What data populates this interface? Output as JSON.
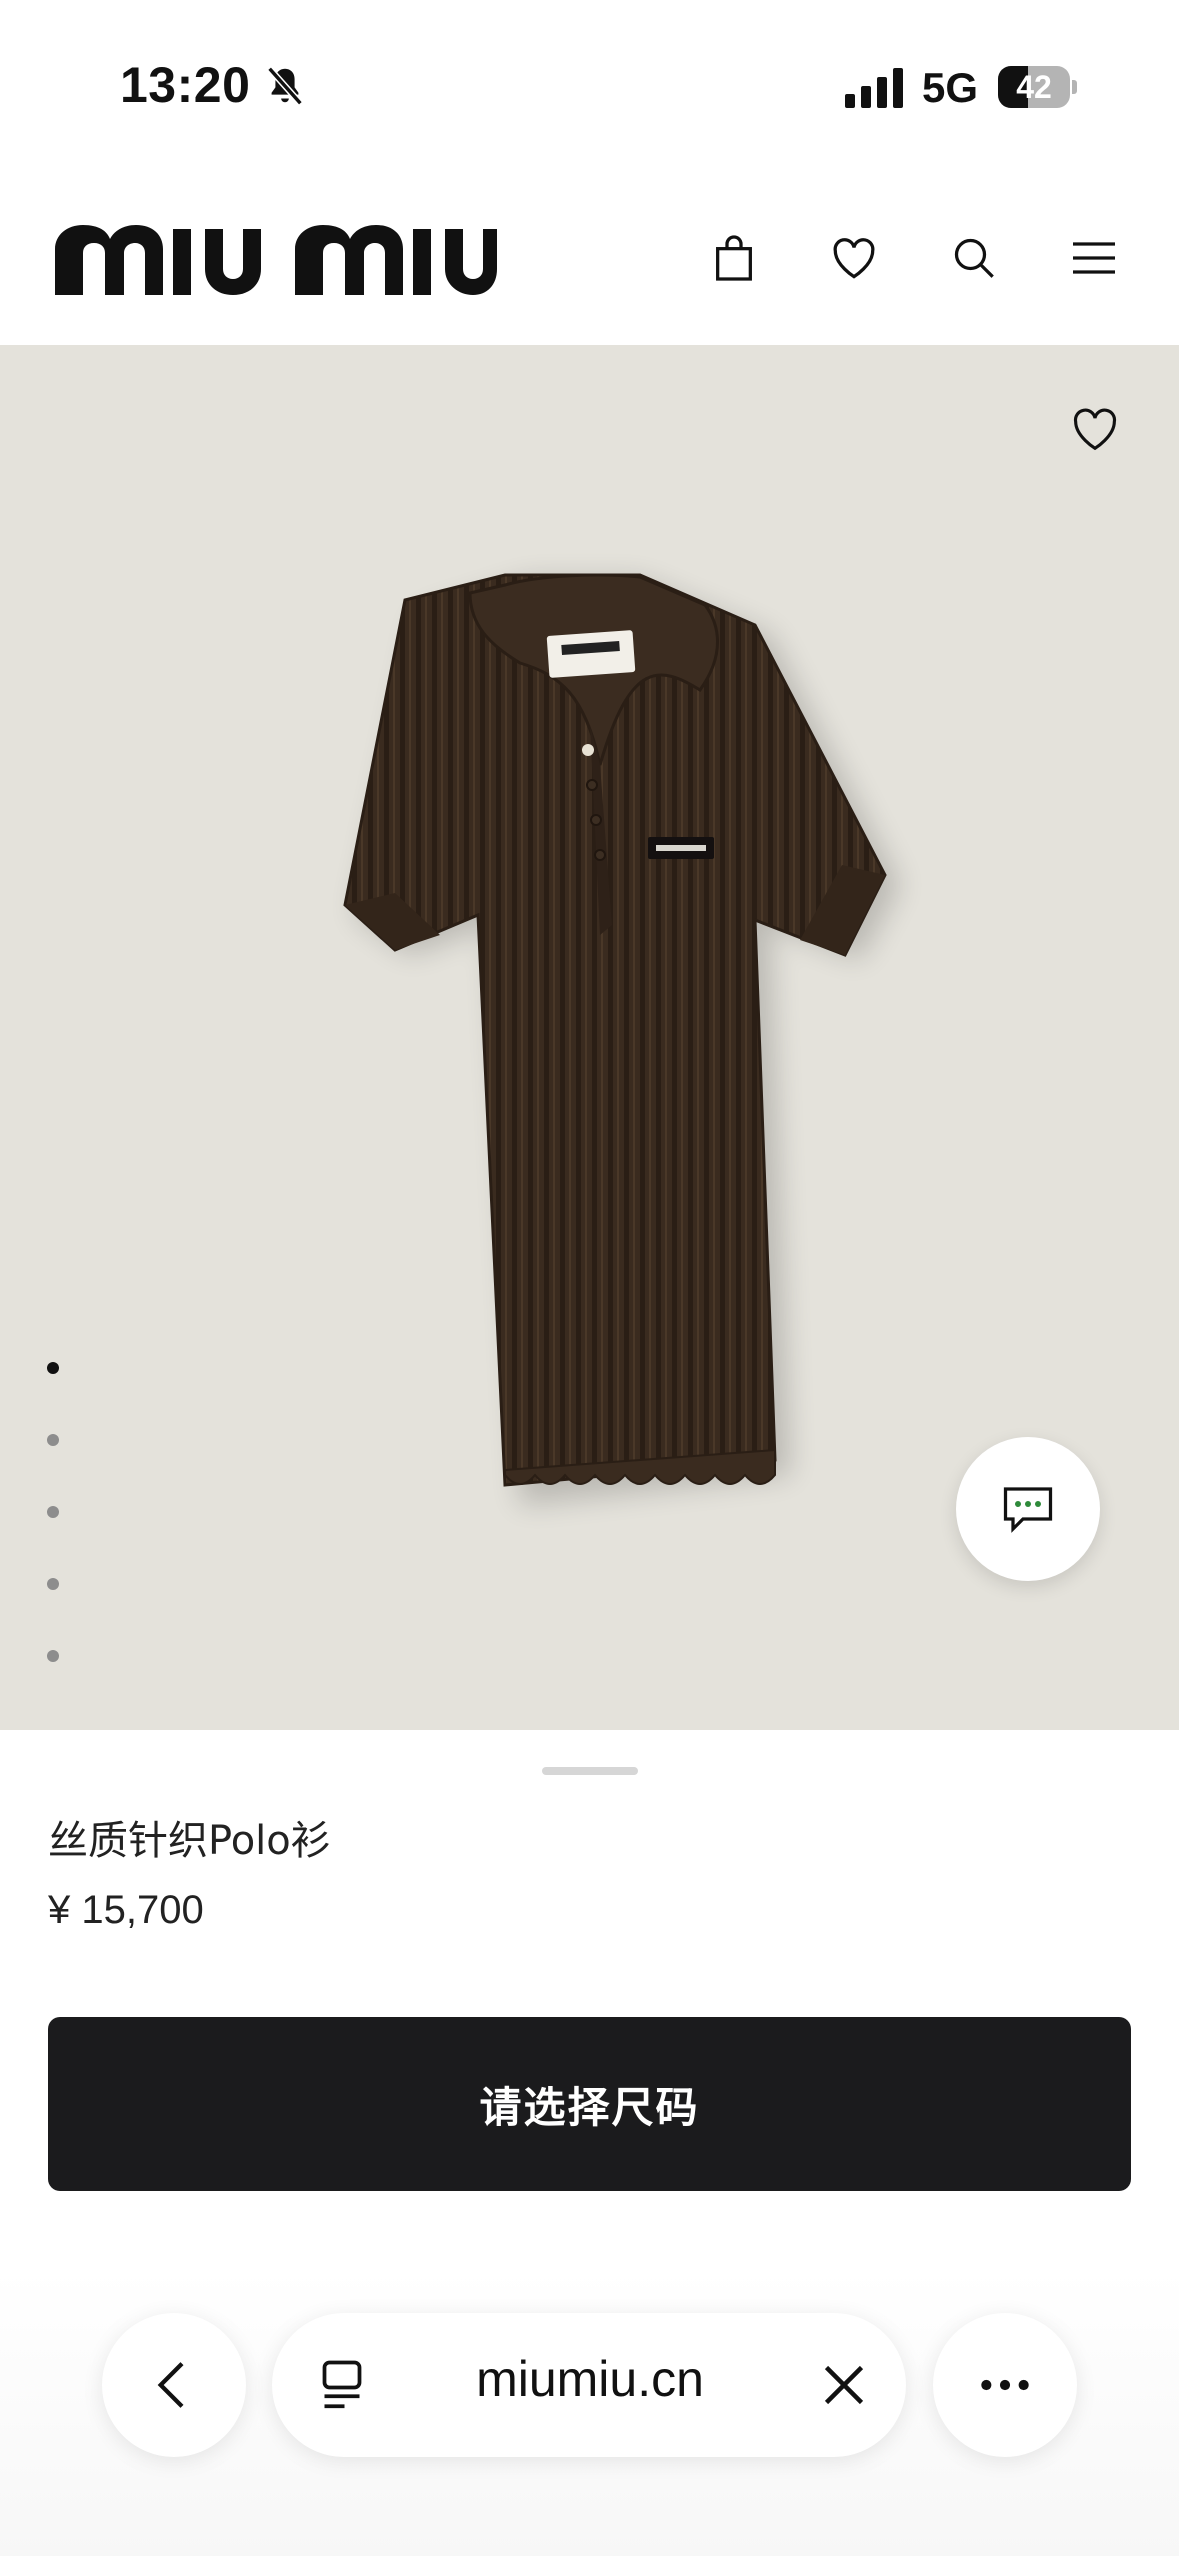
{
  "status_bar": {
    "time": "13:20",
    "network": "5G",
    "battery_percent": "42",
    "battery_level": 0.42,
    "icons": [
      "bell-slash-icon",
      "signal-bars-icon"
    ]
  },
  "header": {
    "logo_text": "miu miu",
    "icons": [
      "shopping-bag-icon",
      "heart-icon",
      "search-icon",
      "menu-icon"
    ]
  },
  "hero": {
    "icons": [
      "heart-outline-icon",
      "chat-bubble-icon"
    ],
    "gallery_count": 5,
    "gallery_active_index": 0,
    "colors": {
      "background": "#e4e2db",
      "garment": "#3a2b1f"
    }
  },
  "product": {
    "name": "丝质针织Polo衫",
    "price": "¥ 15,700",
    "cta_label": "请选择尺码"
  },
  "browser_toolbar": {
    "url": "miumiu.cn",
    "icons": [
      "back-chevron-icon",
      "tabs-icon",
      "clear-icon",
      "more-icon"
    ]
  }
}
